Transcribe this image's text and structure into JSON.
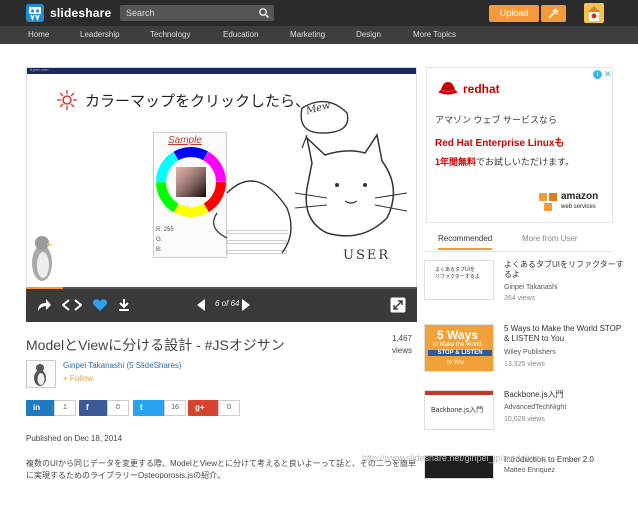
{
  "header": {
    "brand": "slideshare",
    "search_placeholder": "Search",
    "upload_label": "Upload",
    "icons": [
      "search-icon",
      "tools-icon",
      "avatar"
    ]
  },
  "nav": {
    "items": [
      "Home",
      "Leadership",
      "Technology",
      "Education",
      "Marketing",
      "Design",
      "More Topics"
    ]
  },
  "slide": {
    "heading": "カラーマップをクリックしたら、",
    "sample_label": "Sample",
    "fields": [
      "R:",
      "G:",
      "B:"
    ],
    "r_value": "255",
    "handwriting": [
      "Mew",
      "USER"
    ],
    "site_tag": "ti.pen.com"
  },
  "player": {
    "current_page": "6",
    "total_pages": "64",
    "pager_text": "6 of 64",
    "progress": 0.094
  },
  "presentation": {
    "title": "ModelとViewに分ける設計 - #JSオジサン",
    "views_count": "1,467",
    "views_label": "views",
    "author": "Ginpei Takanashi (5 SlideShares)",
    "follow_label": "+ Follow",
    "published": "Published on Dec 18, 2014",
    "description": "複数のUIから同じデータを変更する際、ModelとViewとに分けて考えると良いよーって話と、その二つを簡単に実現するためのライブラリーOsteoporosis.jsの紹介。"
  },
  "share": {
    "linkedin": {
      "glyph": "in",
      "count": "1",
      "color": "#1f7bc1"
    },
    "facebook": {
      "glyph": "f",
      "count": "0",
      "color": "#3b5998"
    },
    "twitter": {
      "glyph": "t",
      "count": "16",
      "color": "#2aa3ef"
    },
    "googleplus": {
      "glyph": "g+",
      "count": "0",
      "color": "#d8432e"
    }
  },
  "ad": {
    "brand": "redhat",
    "line1": "アマゾン ウェブ サービスなら",
    "line2": "Red Hat Enterprise Linuxも",
    "line3_highlight": "1年間無料",
    "line3_rest": "でお試しいただけます。",
    "amazon_brand": "amazon",
    "amazon_sub": "web services"
  },
  "tabs": {
    "recommended": "Recommended",
    "more_from_user": "More from User"
  },
  "related": [
    {
      "title": "よくあるタブUIをリファクターするよ",
      "author": "Ginpei Takanashi",
      "views": "264 views",
      "thumb": "よくあるタブUIを\nリファクターするよ"
    },
    {
      "title": "5 Ways to Make the World STOP & LISTEN to You",
      "author": "Wiley Publishers",
      "views": "13,325 views",
      "thumb_big": "5 Ways",
      "thumb_small": "to Make the World",
      "thumb_bar": "STOP & LISTEN",
      "thumb_tail": "to You"
    },
    {
      "title": "Backbone.js入門",
      "author": "AdvancedTechNight",
      "views": "10,029 views",
      "thumb": "Backbone.js入門"
    },
    {
      "title": "Introduction to Ember 2.0",
      "author": "Matteo Enriquez",
      "views": "",
      "thumb": ""
    }
  ],
  "watermark": "http://www.slideshare.net/ginpei_jp/modelview",
  "colors": {
    "topbar": "#2b2b2b",
    "nav": "#3e3e3e",
    "accent": "#f49a3b",
    "link": "#2a6ea6",
    "redhat": "#cc0000"
  }
}
